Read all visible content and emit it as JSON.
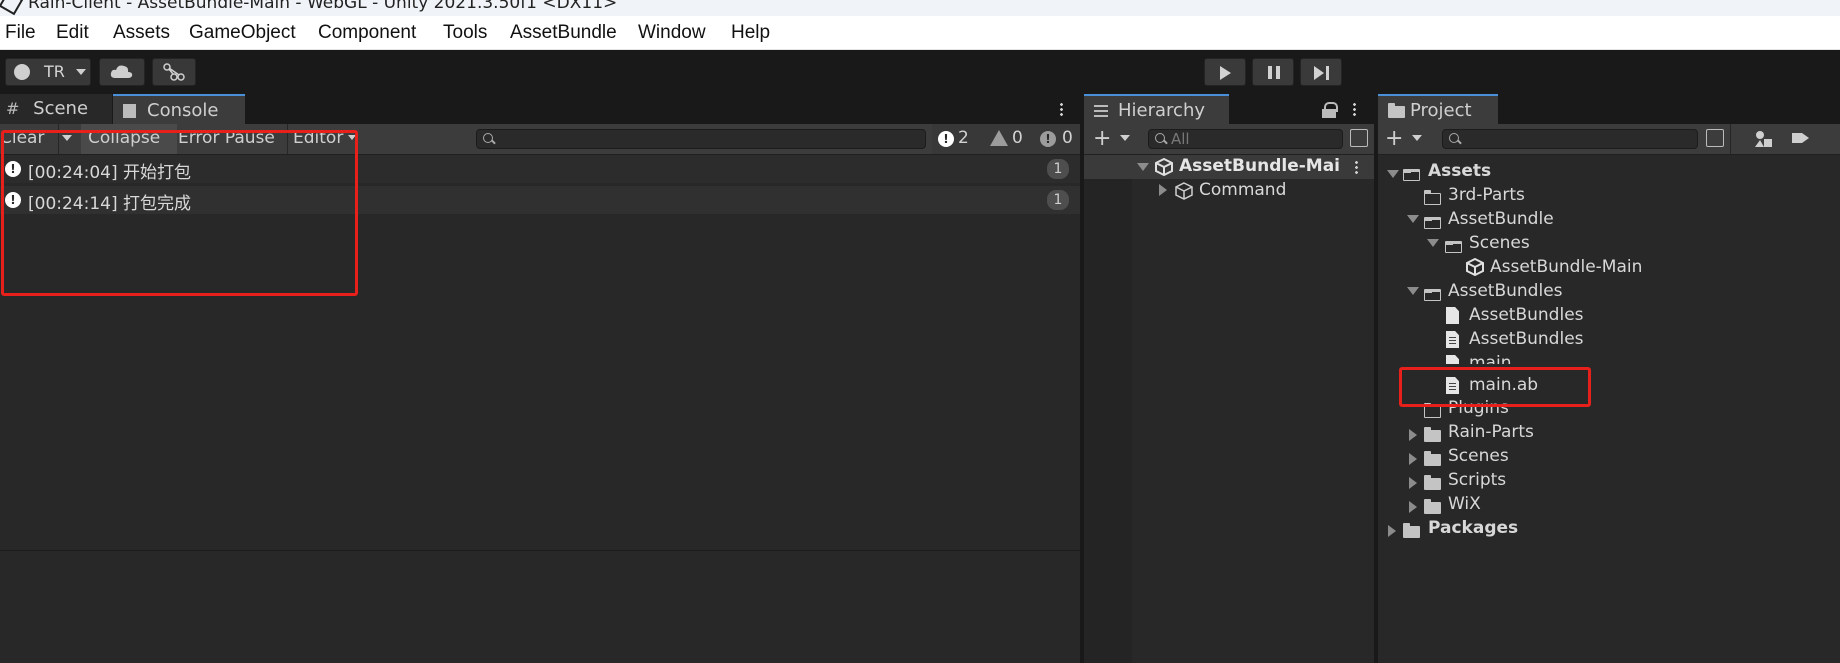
{
  "window": {
    "title": "Rain-Client - AssetBundle-Main - WebGL - Unity 2021.3.50f1 <DX11>"
  },
  "menu": [
    "File",
    "Edit",
    "Assets",
    "GameObject",
    "Component",
    "Tools",
    "AssetBundle",
    "Window",
    "Help"
  ],
  "toolbar": {
    "account_label": "TR"
  },
  "left_panel": {
    "tabs": [
      "Scene",
      "Console"
    ],
    "active_tab": "Console",
    "console_toolbar": {
      "clear": "Clear",
      "collapse": "Collapse",
      "error_pause": "Error Pause",
      "editor": "Editor"
    },
    "counts": {
      "log": "2",
      "warn": "0",
      "error": "0"
    },
    "entries": [
      {
        "text": "[00:24:04] 开始打包",
        "count": "1"
      },
      {
        "text": "[00:24:14] 打包完成",
        "count": "1"
      }
    ]
  },
  "hierarchy": {
    "tab": "Hierarchy",
    "search_placeholder": "All",
    "scene": "AssetBundle-Mai",
    "children": [
      "Command"
    ]
  },
  "project": {
    "tab": "Project",
    "tree": {
      "assets": "Assets",
      "third": "3rd-Parts",
      "assetbundle": "AssetBundle",
      "scenes_sub": "Scenes",
      "scene_file": "AssetBundle-Main",
      "assetbundles": "AssetBundles",
      "ab_file1": "AssetBundles",
      "ab_file2": "AssetBundles",
      "main": "main",
      "main_ab": "main.ab",
      "plugins": "Plugins",
      "rainparts": "Rain-Parts",
      "scenes": "Scenes",
      "scripts": "Scripts",
      "wix": "WiX",
      "packages": "Packages"
    }
  },
  "colors": {
    "highlight": "#e8201c",
    "accent": "#4a90d9"
  }
}
